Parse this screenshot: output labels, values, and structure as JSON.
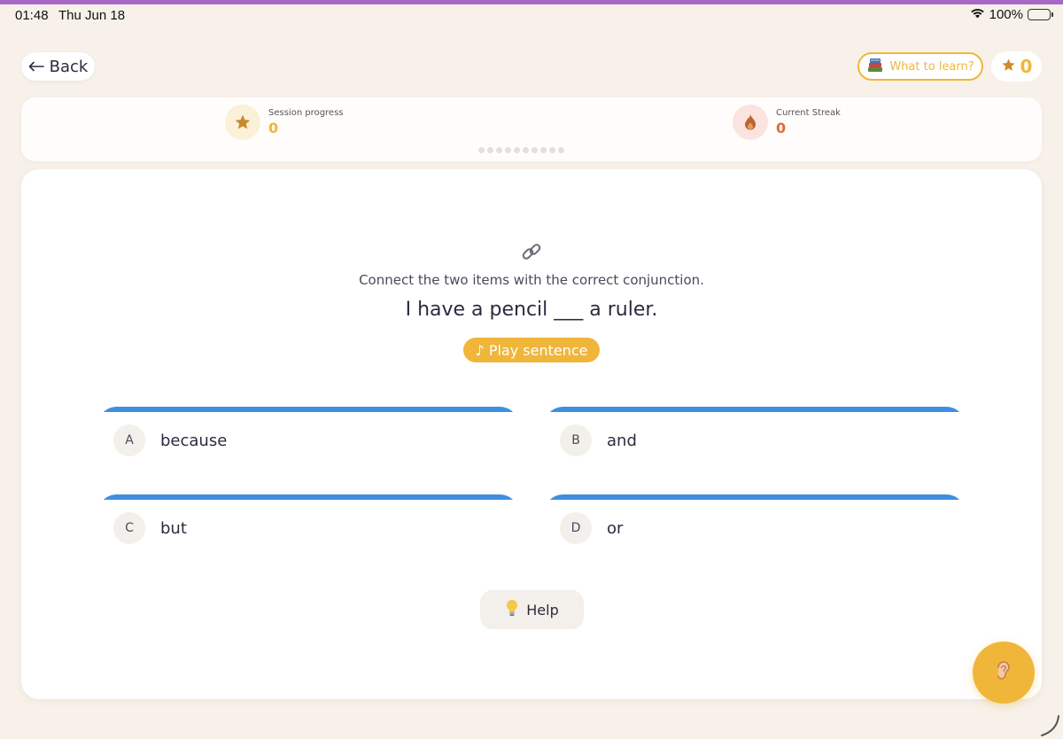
{
  "status_bar": {
    "time": "01:48",
    "date": "Thu Jun 18",
    "battery": "100%"
  },
  "header": {
    "back_label": "Back",
    "what_to_learn_label": "What to learn?",
    "stars_count": "0"
  },
  "progress": {
    "session_label": "Session progress",
    "session_value": "0",
    "streak_label": "Current Streak",
    "streak_value": "0",
    "dots_total": 10
  },
  "question": {
    "instruction": "Connect the two items with the correct conjunction.",
    "sentence": "I have a pencil ___ a ruler.",
    "play_label": "♪ Play sentence"
  },
  "options": [
    {
      "letter": "A",
      "text": "because"
    },
    {
      "letter": "B",
      "text": "and"
    },
    {
      "letter": "C",
      "text": "but"
    },
    {
      "letter": "D",
      "text": "or"
    }
  ],
  "help_label": "Help",
  "colors": {
    "accent": "#f0b63a",
    "option_top": "#3f8fe0",
    "streak": "#e06a3b",
    "top_accent": "#a868c8"
  }
}
